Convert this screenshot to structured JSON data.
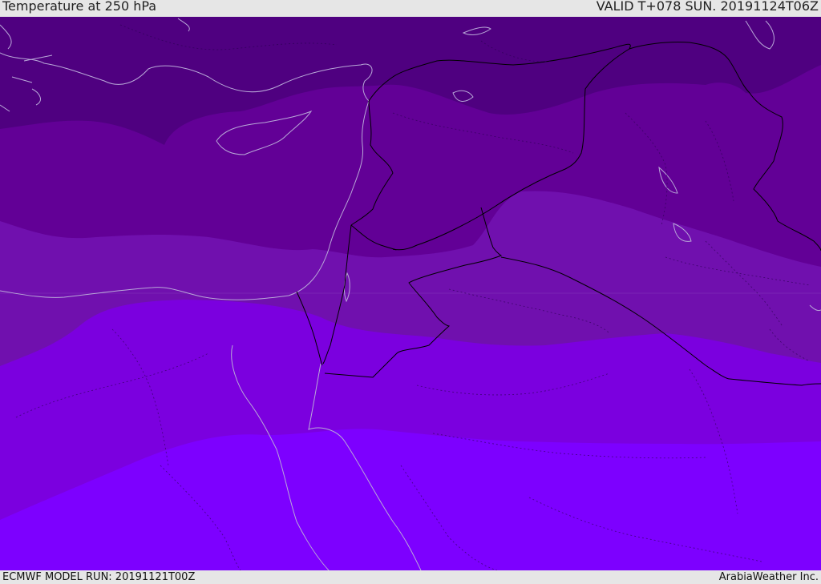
{
  "header": {
    "title": "Temperature at 250 hPa",
    "valid": "VALID T+078 SUN. 20191124T06Z"
  },
  "footer": {
    "model_run": "ECMWF MODEL RUN: 20191121T00Z",
    "brand": "ArabiaWeather Inc."
  },
  "colors": {
    "band_1": "#4f0080",
    "band_2": "#620096",
    "band_3": "#7010ae",
    "band_4": "#7b00df",
    "band_5": "#7d00ff",
    "coastline": "#b9a8d8",
    "border": "#000000"
  }
}
